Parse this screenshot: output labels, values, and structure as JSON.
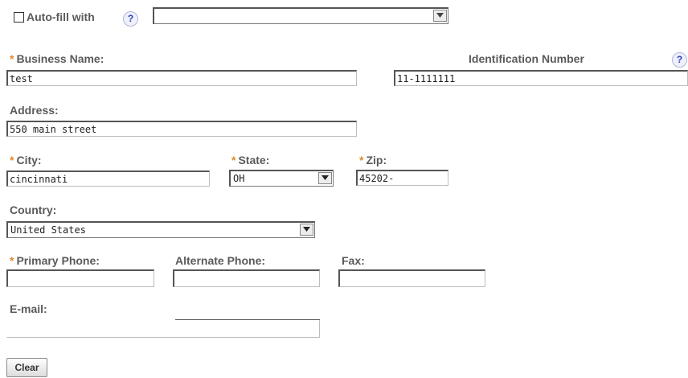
{
  "autofill": {
    "label": "Auto-fill with",
    "checked": false,
    "select_value": "",
    "help_symbol": "?"
  },
  "business_name": {
    "required_marker": "*",
    "label": "Business Name:",
    "value": "test"
  },
  "identification_number": {
    "label": "Identification Number",
    "value": "11-1111111",
    "help_symbol": "?"
  },
  "address": {
    "label": "Address:",
    "value": "550 main street"
  },
  "city": {
    "required_marker": "*",
    "label": "City:",
    "value": "cincinnati"
  },
  "state": {
    "required_marker": "*",
    "label": "State:",
    "value": "OH"
  },
  "zip": {
    "required_marker": "*",
    "label": "Zip:",
    "value": "45202-"
  },
  "country": {
    "label": "Country:",
    "value": "United States"
  },
  "primary_phone": {
    "required_marker": "*",
    "label": "Primary Phone:",
    "value": ""
  },
  "alternate_phone": {
    "label": "Alternate Phone:",
    "value": ""
  },
  "fax": {
    "label": "Fax:",
    "value": ""
  },
  "email": {
    "label": "E-mail:",
    "value": ""
  },
  "clear_button": {
    "label": "Clear"
  },
  "colors": {
    "label_text": "#5a5a5a",
    "required_marker": "#e08a2c",
    "help_icon": "#2d3fb3"
  }
}
